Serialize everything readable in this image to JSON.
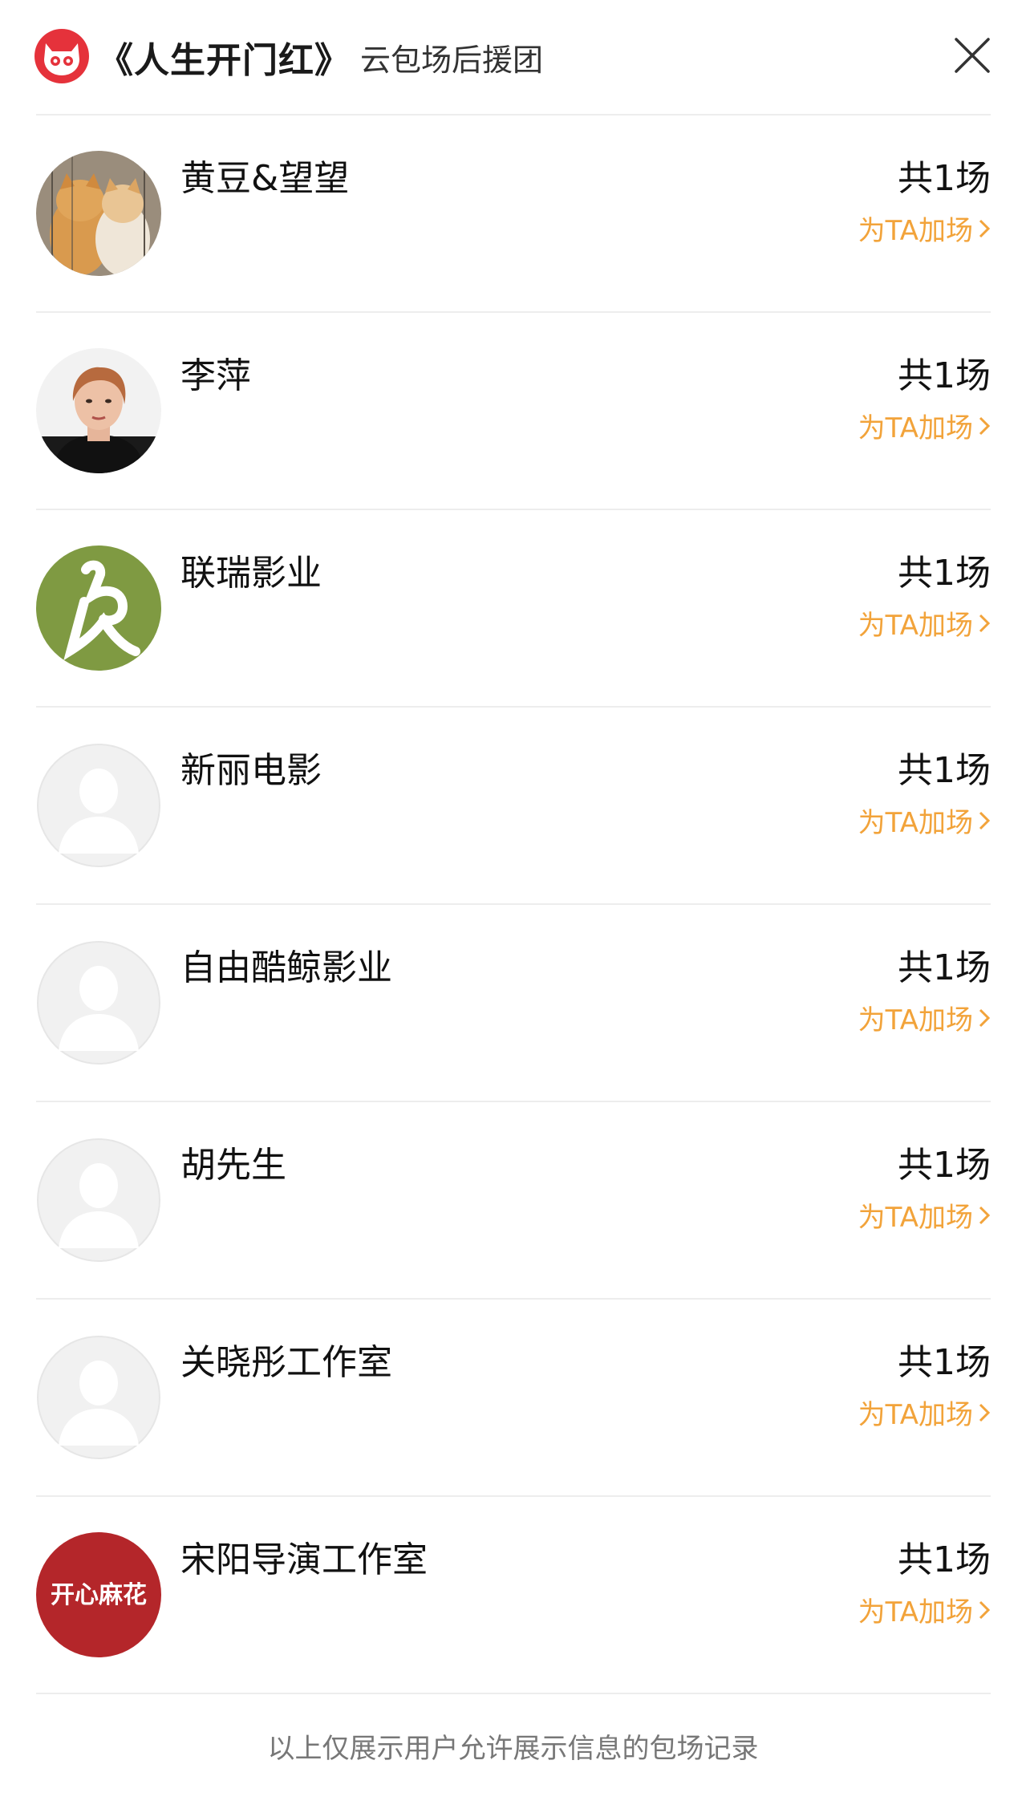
{
  "header": {
    "movie_title": "《人生开门红》",
    "subtitle": "云包场后援团",
    "logo_icon": "maoyan-cat-logo-icon",
    "close_icon": "close-icon"
  },
  "accent_color": "#f2a33a",
  "supporters": [
    {
      "name": "黄豆&望望",
      "count": "共1场",
      "action": "为TA加场",
      "avatar": "cats-photo"
    },
    {
      "name": "李萍",
      "count": "共1场",
      "action": "为TA加场",
      "avatar": "woman-photo"
    },
    {
      "name": "联瑞影业",
      "count": "共1场",
      "action": "为TA加场",
      "avatar": "lianrui-logo"
    },
    {
      "name": "新丽电影",
      "count": "共1场",
      "action": "为TA加场",
      "avatar": "default-user"
    },
    {
      "name": "自由酷鲸影业",
      "count": "共1场",
      "action": "为TA加场",
      "avatar": "default-user"
    },
    {
      "name": "胡先生",
      "count": "共1场",
      "action": "为TA加场",
      "avatar": "default-user"
    },
    {
      "name": "关晓彤工作室",
      "count": "共1场",
      "action": "为TA加场",
      "avatar": "default-user"
    },
    {
      "name": "宋阳导演工作室",
      "count": "共1场",
      "action": "为TA加场",
      "avatar": "kaixin-mahua-logo",
      "avatar_text": "开心麻花"
    }
  ],
  "footer_note": "以上仅展示用户允许展示信息的包场记录"
}
